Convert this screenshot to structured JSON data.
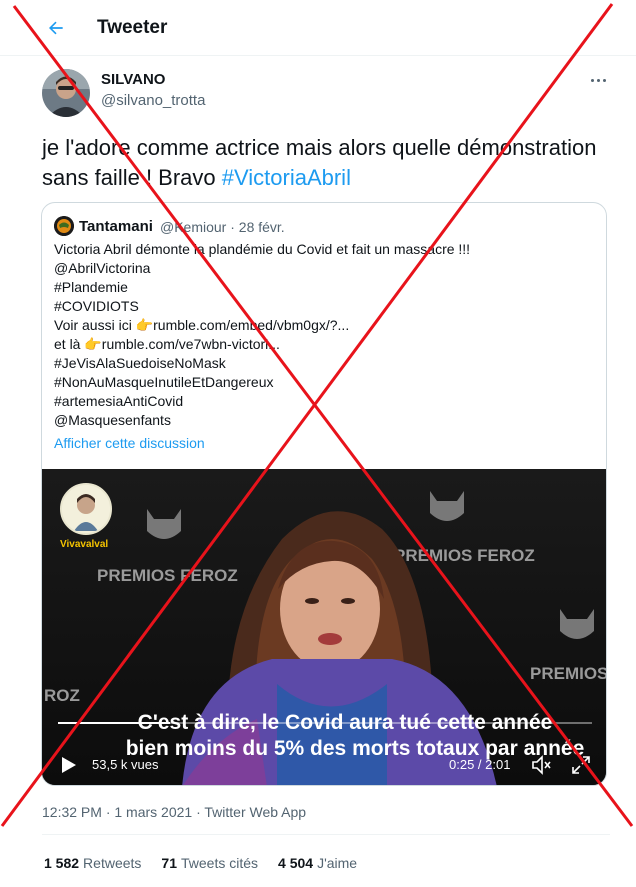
{
  "header": {
    "title": "Tweeter"
  },
  "tweet": {
    "author_name": "SILVANO",
    "author_handle": "@silvano_trotta",
    "text": "je l'adore comme actrice mais alors quelle démonstration sans faille ! Bravo ",
    "hashtag": "#VictoriaAbril",
    "timestamp": "12:32 PM · 1 mars 2021 · Twitter Web App"
  },
  "quoted": {
    "name": "Tantamani",
    "meta": "@Kemiour · 28 févr.",
    "lines": [
      "Victoria Abril démonte la plandémie du Covid et fait un massacre !!!",
      "@AbrilVictorina",
      "#Plandemie",
      "#COVIDIOTS",
      "Voir aussi ici 👉rumble.com/embed/vbm0gx/?...",
      "et là 👉rumble.com/ve7wbn-victori...",
      "#JeVisAlaSuedoiseNoMask",
      "#NonAuMasqueInutileEtDangereux",
      "#artemesiaAntiCovid",
      "@Masquesenfants"
    ],
    "thread_link": "Afficher cette discussion"
  },
  "video": {
    "channel_name": "Vivavalval",
    "subtitle_line1": "C'est à dire, le Covid aura tué cette année",
    "subtitle_line2": "bien moins du 5% des morts totaux par année",
    "views": "53,5 k vues",
    "time": "0:25 / 2:01",
    "progress": 0.21,
    "backdrop_text_1": "PREMIOS FEROZ",
    "backdrop_text_2": "PREMIOS FEROZ",
    "backdrop_text_3": "PREMIOS FE",
    "backdrop_text_4": "ROZ"
  },
  "stats": {
    "retweets_count": "1 582",
    "retweets_label": "Retweets",
    "quotes_count": "71",
    "quotes_label": "Tweets cités",
    "likes_count": "4 504",
    "likes_label": "J'aime"
  },
  "colors": {
    "accent": "#1d9bf0",
    "cross": "#e8131b",
    "text": "#0f1419",
    "secondary": "#536471"
  }
}
